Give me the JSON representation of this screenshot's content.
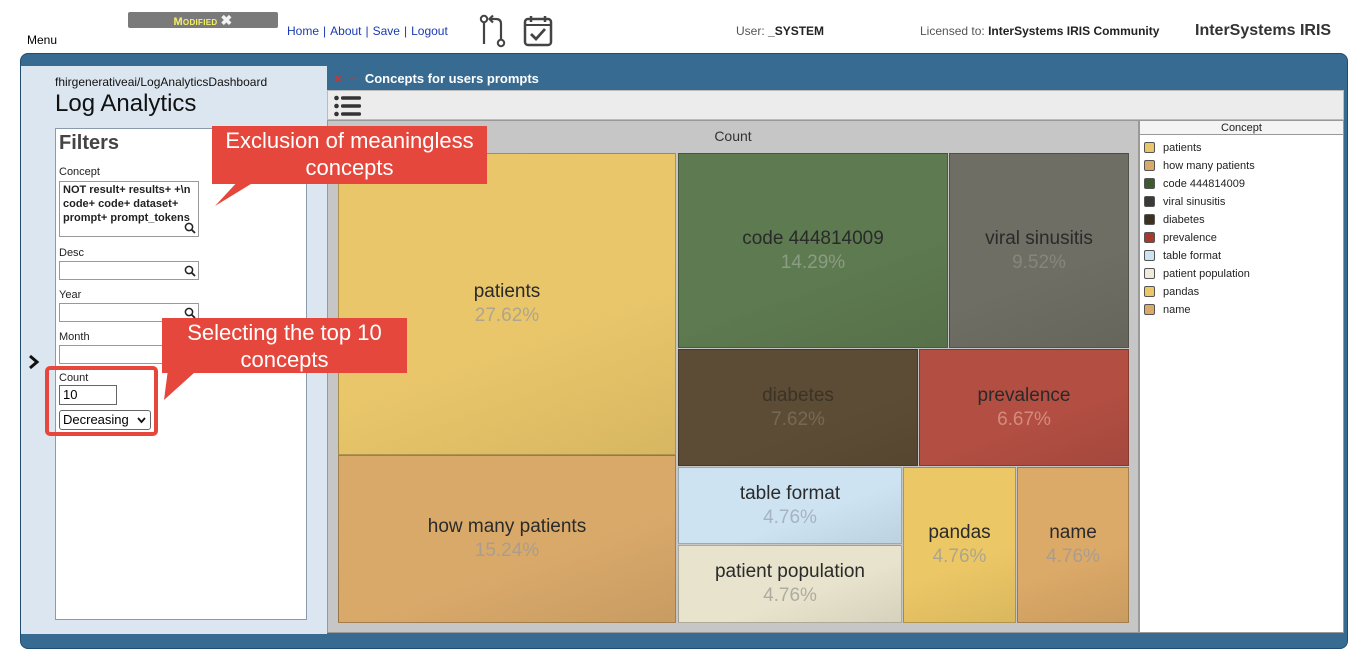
{
  "topbar": {
    "menu_label": "Menu",
    "modified_label": "Modified",
    "modified_close_glyph": "✖",
    "nav": [
      "Home",
      "About",
      "Save",
      "Logout"
    ],
    "user_label": "User:",
    "user_value": "_SYSTEM",
    "license_label": "Licensed to:",
    "license_value": "InterSystems IRIS Community",
    "brand": "InterSystems IRIS",
    "icons": [
      "git-compare-icon",
      "calendar-check-icon"
    ]
  },
  "sidebar": {
    "breadcrumb": "fhirgenerativeai/LogAnalyticsDashboard",
    "title": "Log Analytics",
    "expand_glyph": "›",
    "filters_title": "Filters",
    "concept_label": "Concept",
    "concept_value": "NOT result+ results+ +\\n code+ code+ dataset+ prompt+ prompt_tokens",
    "desc_label": "Desc",
    "desc_value": "",
    "year_label": "Year",
    "year_value": "",
    "month_label": "Month",
    "month_value": "",
    "count_label": "Count",
    "count_value": "10",
    "sort_value": "Decreasing"
  },
  "portlet": {
    "close_glyph": "×",
    "minimize_glyph": "–",
    "title": "Concepts for users prompts",
    "menu_icon": "list-menu-icon"
  },
  "annotations": {
    "exclusion": "Exclusion of meaningless concepts",
    "top10": "Selecting the top 10 concepts",
    "accent_color": "#e5473d"
  },
  "chart_data": {
    "type": "treemap",
    "title": "Count",
    "legend_title": "Concept",
    "legend_position": "right",
    "items": [
      {
        "label": "patients",
        "percent": "27.62%",
        "value": 27.62,
        "color": "#e9c66a"
      },
      {
        "label": "how many patients",
        "percent": "15.24%",
        "value": 15.24,
        "color": "#d9a96a"
      },
      {
        "label": "code 444814009",
        "percent": "14.29%",
        "value": 14.29,
        "color": "#5e7a50"
      },
      {
        "label": "viral sinusitis",
        "percent": "9.52%",
        "value": 9.52,
        "color": "#6e6e64"
      },
      {
        "label": "diabetes",
        "percent": "7.62%",
        "value": 7.62,
        "color": "#5d4c35"
      },
      {
        "label": "prevalence",
        "percent": "6.67%",
        "value": 6.67,
        "color": "#b24e42"
      },
      {
        "label": "table format",
        "percent": "4.76%",
        "value": 4.76,
        "color": "#cde3f2"
      },
      {
        "label": "patient population",
        "percent": "4.76%",
        "value": 4.76,
        "color": "#e8e3cc"
      },
      {
        "label": "pandas",
        "percent": "4.76%",
        "value": 4.76,
        "color": "#ecc766"
      },
      {
        "label": "name",
        "percent": "4.76%",
        "value": 4.76,
        "color": "#dba968"
      }
    ],
    "legend_colors": [
      "#e9c66a",
      "#d9a96a",
      "#3d5a31",
      "#3b3b35",
      "#3d3120",
      "#a63a2e",
      "#cde3f2",
      "#efeadb",
      "#ecc766",
      "#dba968"
    ]
  }
}
